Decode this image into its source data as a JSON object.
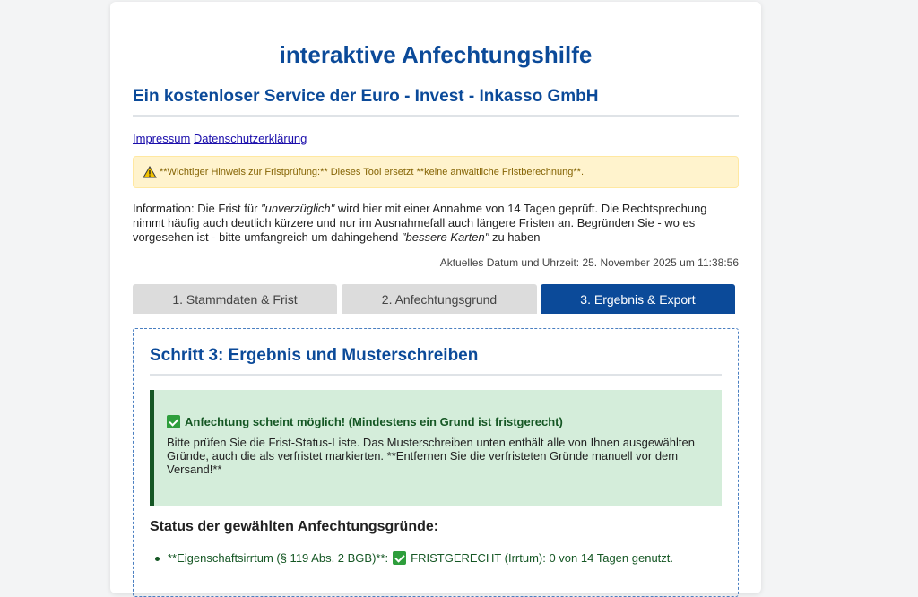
{
  "header": {
    "title": "interaktive Anfechtungshilfe",
    "subtitle": "Ein kostenloser Service der Euro - Invest - Inkasso GmbH"
  },
  "links": {
    "impressum": "Impressum",
    "datenschutz": "Datenschutzerklärung"
  },
  "warning": {
    "icon": "warning-icon",
    "text": "**Wichtiger Hinweis zur Fristprüfung:** Dieses Tool ersetzt **keine anwaltliche Fristberechnung**."
  },
  "info": {
    "part1": "Information: Die Frist für ",
    "em1": "\"unverzüglich\"",
    "part2": " wird hier mit einer Annahme von 14 Tagen geprüft. Die Rechtsprechung nimmt häufig auch deutlich kürzere und nur im Ausnahmefall auch längere Fristen an. Begründen Sie - wo es vorgesehen ist - bitte umfangreich um dahingehend ",
    "em2": "\"bessere Karten\"",
    "part3": " zu haben"
  },
  "datetime": "Aktuelles Datum und Uhrzeit: 25. November 2025 um 11:38:56",
  "tabs": [
    {
      "label": "1. Stammdaten & Frist",
      "active": false
    },
    {
      "label": "2. Anfechtungsgrund",
      "active": false
    },
    {
      "label": "3. Ergebnis & Export",
      "active": true
    }
  ],
  "step": {
    "title": "Schritt 3: Ergebnis und Musterschreiben",
    "success_heading": "Anfechtung scheint möglich! (Mindestens ein Grund ist fristgerecht)",
    "success_body": "Bitte prüfen Sie die Frist-Status-Liste. Das Musterschreiben unten enthält alle von Ihnen ausgewählten Gründe, auch die als verfristet markierten. **Entfernen Sie die verfristeten Gründe manuell vor dem Versand!**",
    "status_heading": "Status der gewählten Anfechtungsgründe:",
    "status_items": [
      {
        "label": "**Eigenschaftsirrtum (§ 119 Abs. 2 BGB)**:",
        "status": "FRISTGERECHT (Irrtum): 0 von 14 Tagen genutzt."
      }
    ]
  },
  "colors": {
    "primary": "#0b4a99",
    "success_bg": "#d4edda",
    "success_text": "#155724",
    "warning_bg": "#fff3cd",
    "warning_text": "#856404"
  }
}
